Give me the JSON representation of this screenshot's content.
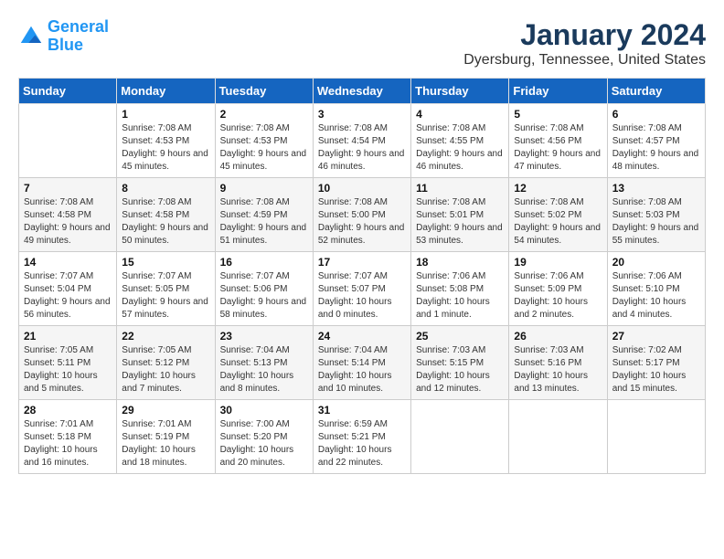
{
  "logo": {
    "line1": "General",
    "line2": "Blue"
  },
  "title": "January 2024",
  "location": "Dyersburg, Tennessee, United States",
  "weekdays": [
    "Sunday",
    "Monday",
    "Tuesday",
    "Wednesday",
    "Thursday",
    "Friday",
    "Saturday"
  ],
  "weeks": [
    [
      {
        "day": "",
        "sunrise": "",
        "sunset": "",
        "daylight": ""
      },
      {
        "day": "1",
        "sunrise": "Sunrise: 7:08 AM",
        "sunset": "Sunset: 4:53 PM",
        "daylight": "Daylight: 9 hours and 45 minutes."
      },
      {
        "day": "2",
        "sunrise": "Sunrise: 7:08 AM",
        "sunset": "Sunset: 4:53 PM",
        "daylight": "Daylight: 9 hours and 45 minutes."
      },
      {
        "day": "3",
        "sunrise": "Sunrise: 7:08 AM",
        "sunset": "Sunset: 4:54 PM",
        "daylight": "Daylight: 9 hours and 46 minutes."
      },
      {
        "day": "4",
        "sunrise": "Sunrise: 7:08 AM",
        "sunset": "Sunset: 4:55 PM",
        "daylight": "Daylight: 9 hours and 46 minutes."
      },
      {
        "day": "5",
        "sunrise": "Sunrise: 7:08 AM",
        "sunset": "Sunset: 4:56 PM",
        "daylight": "Daylight: 9 hours and 47 minutes."
      },
      {
        "day": "6",
        "sunrise": "Sunrise: 7:08 AM",
        "sunset": "Sunset: 4:57 PM",
        "daylight": "Daylight: 9 hours and 48 minutes."
      }
    ],
    [
      {
        "day": "7",
        "sunrise": "Sunrise: 7:08 AM",
        "sunset": "Sunset: 4:58 PM",
        "daylight": "Daylight: 9 hours and 49 minutes."
      },
      {
        "day": "8",
        "sunrise": "Sunrise: 7:08 AM",
        "sunset": "Sunset: 4:58 PM",
        "daylight": "Daylight: 9 hours and 50 minutes."
      },
      {
        "day": "9",
        "sunrise": "Sunrise: 7:08 AM",
        "sunset": "Sunset: 4:59 PM",
        "daylight": "Daylight: 9 hours and 51 minutes."
      },
      {
        "day": "10",
        "sunrise": "Sunrise: 7:08 AM",
        "sunset": "Sunset: 5:00 PM",
        "daylight": "Daylight: 9 hours and 52 minutes."
      },
      {
        "day": "11",
        "sunrise": "Sunrise: 7:08 AM",
        "sunset": "Sunset: 5:01 PM",
        "daylight": "Daylight: 9 hours and 53 minutes."
      },
      {
        "day": "12",
        "sunrise": "Sunrise: 7:08 AM",
        "sunset": "Sunset: 5:02 PM",
        "daylight": "Daylight: 9 hours and 54 minutes."
      },
      {
        "day": "13",
        "sunrise": "Sunrise: 7:08 AM",
        "sunset": "Sunset: 5:03 PM",
        "daylight": "Daylight: 9 hours and 55 minutes."
      }
    ],
    [
      {
        "day": "14",
        "sunrise": "Sunrise: 7:07 AM",
        "sunset": "Sunset: 5:04 PM",
        "daylight": "Daylight: 9 hours and 56 minutes."
      },
      {
        "day": "15",
        "sunrise": "Sunrise: 7:07 AM",
        "sunset": "Sunset: 5:05 PM",
        "daylight": "Daylight: 9 hours and 57 minutes."
      },
      {
        "day": "16",
        "sunrise": "Sunrise: 7:07 AM",
        "sunset": "Sunset: 5:06 PM",
        "daylight": "Daylight: 9 hours and 58 minutes."
      },
      {
        "day": "17",
        "sunrise": "Sunrise: 7:07 AM",
        "sunset": "Sunset: 5:07 PM",
        "daylight": "Daylight: 10 hours and 0 minutes."
      },
      {
        "day": "18",
        "sunrise": "Sunrise: 7:06 AM",
        "sunset": "Sunset: 5:08 PM",
        "daylight": "Daylight: 10 hours and 1 minute."
      },
      {
        "day": "19",
        "sunrise": "Sunrise: 7:06 AM",
        "sunset": "Sunset: 5:09 PM",
        "daylight": "Daylight: 10 hours and 2 minutes."
      },
      {
        "day": "20",
        "sunrise": "Sunrise: 7:06 AM",
        "sunset": "Sunset: 5:10 PM",
        "daylight": "Daylight: 10 hours and 4 minutes."
      }
    ],
    [
      {
        "day": "21",
        "sunrise": "Sunrise: 7:05 AM",
        "sunset": "Sunset: 5:11 PM",
        "daylight": "Daylight: 10 hours and 5 minutes."
      },
      {
        "day": "22",
        "sunrise": "Sunrise: 7:05 AM",
        "sunset": "Sunset: 5:12 PM",
        "daylight": "Daylight: 10 hours and 7 minutes."
      },
      {
        "day": "23",
        "sunrise": "Sunrise: 7:04 AM",
        "sunset": "Sunset: 5:13 PM",
        "daylight": "Daylight: 10 hours and 8 minutes."
      },
      {
        "day": "24",
        "sunrise": "Sunrise: 7:04 AM",
        "sunset": "Sunset: 5:14 PM",
        "daylight": "Daylight: 10 hours and 10 minutes."
      },
      {
        "day": "25",
        "sunrise": "Sunrise: 7:03 AM",
        "sunset": "Sunset: 5:15 PM",
        "daylight": "Daylight: 10 hours and 12 minutes."
      },
      {
        "day": "26",
        "sunrise": "Sunrise: 7:03 AM",
        "sunset": "Sunset: 5:16 PM",
        "daylight": "Daylight: 10 hours and 13 minutes."
      },
      {
        "day": "27",
        "sunrise": "Sunrise: 7:02 AM",
        "sunset": "Sunset: 5:17 PM",
        "daylight": "Daylight: 10 hours and 15 minutes."
      }
    ],
    [
      {
        "day": "28",
        "sunrise": "Sunrise: 7:01 AM",
        "sunset": "Sunset: 5:18 PM",
        "daylight": "Daylight: 10 hours and 16 minutes."
      },
      {
        "day": "29",
        "sunrise": "Sunrise: 7:01 AM",
        "sunset": "Sunset: 5:19 PM",
        "daylight": "Daylight: 10 hours and 18 minutes."
      },
      {
        "day": "30",
        "sunrise": "Sunrise: 7:00 AM",
        "sunset": "Sunset: 5:20 PM",
        "daylight": "Daylight: 10 hours and 20 minutes."
      },
      {
        "day": "31",
        "sunrise": "Sunrise: 6:59 AM",
        "sunset": "Sunset: 5:21 PM",
        "daylight": "Daylight: 10 hours and 22 minutes."
      },
      {
        "day": "",
        "sunrise": "",
        "sunset": "",
        "daylight": ""
      },
      {
        "day": "",
        "sunrise": "",
        "sunset": "",
        "daylight": ""
      },
      {
        "day": "",
        "sunrise": "",
        "sunset": "",
        "daylight": ""
      }
    ]
  ]
}
